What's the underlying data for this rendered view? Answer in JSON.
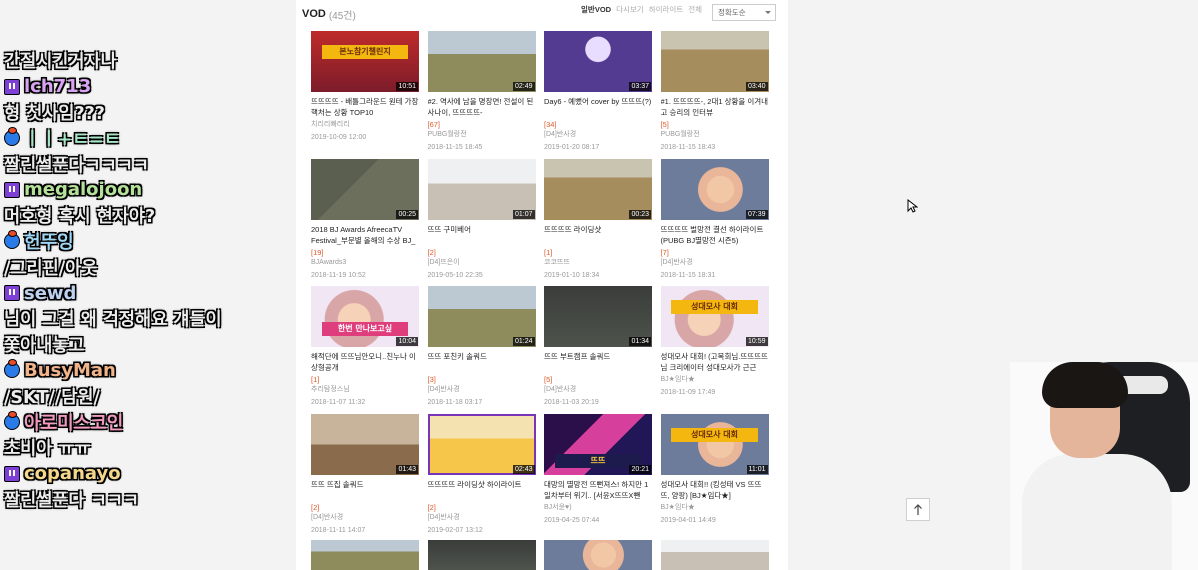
{
  "chat": [
    {
      "kind": "msg",
      "text": "간절시킨거자나"
    },
    {
      "kind": "user",
      "platform": "twitch-icon",
      "name": "lch713",
      "color": "#d9a2f2"
    },
    {
      "kind": "msg",
      "text": "형 첫사임???"
    },
    {
      "kind": "user",
      "platform": "afreeca-icon",
      "name": "ㅣㅣ+ㅌ=ㅌ",
      "color": "#a6e6c6"
    },
    {
      "kind": "msg",
      "text": "짤린썰푼다ㅋㅋㅋㅋ"
    },
    {
      "kind": "user",
      "platform": "twitch-icon",
      "name": "megalojoon",
      "color": "#b5e29b"
    },
    {
      "kind": "msg",
      "text": "머호형 혹시 현자야?"
    },
    {
      "kind": "user",
      "platform": "afreeca-icon",
      "name": "헌뚜잉",
      "color": "#9fd6f4"
    },
    {
      "kind": "msg",
      "text": "/그리핀/아웃"
    },
    {
      "kind": "user",
      "platform": "twitch-icon",
      "name": "sewd",
      "color": "#bcd2ef"
    },
    {
      "kind": "msg",
      "text": "님이 그걸 왜 걱정해요 걔들이"
    },
    {
      "kind": "msg",
      "text": "쫓아내놓고"
    },
    {
      "kind": "user",
      "platform": "afreeca-icon",
      "name": "BusyMan",
      "color": "#f1b38a"
    },
    {
      "kind": "msg",
      "text": "/SKT//담원/"
    },
    {
      "kind": "user",
      "platform": "afreeca-icon",
      "name": "아로미스코인",
      "color": "#f39ac0"
    },
    {
      "kind": "msg",
      "text": "초비아 ㅠㅠ"
    },
    {
      "kind": "user",
      "platform": "twitch-icon",
      "name": "copanayo",
      "color": "#f3d88b"
    },
    {
      "kind": "msg",
      "text": "짤린썰푼다 ㅋㅋㅋ"
    }
  ],
  "vod": {
    "title": "VOD",
    "count": "(45건)",
    "tabs": [
      "일반VOD",
      "다시보기",
      "하이라이트",
      "전체"
    ],
    "sort": "정확도순"
  },
  "cards": [
    {
      "title": "뜨뜨뜨뜨 - 배틀그라운드 원테 가장 핵처는 상황 TOP10",
      "comments": "",
      "author": "치리리빠리리",
      "date": "2019-10-09 12:00",
      "duration": "10:51",
      "art": "t-red",
      "band": "본노참기챌린지",
      "band_style": "yellow"
    },
    {
      "title": "#2. 역사에 남을 명장면! 전설이 된 사나이, 뜨뜨뜨뜨-",
      "comments": "[67]",
      "author": "PUBG월랑전",
      "date": "2018-11-15 18:45",
      "duration": "02:49",
      "art": "t-field",
      "band": "",
      "band_style": ""
    },
    {
      "title": "Day6 - 예뻤어 cover by 뜨뜨뜨(?)",
      "comments": "[34]",
      "author": "[D4]반사경",
      "date": "2019-01-20 08:17",
      "duration": "03:37",
      "art": "t-purple",
      "band": "",
      "band_style": ""
    },
    {
      "title": "#1. 뜨뜨뜨뜨-, 2대1 상황을 이겨내고 승리의 인터뷰",
      "comments": "[5]",
      "author": "PUBG월랑전",
      "date": "2018-11-15 18:43",
      "duration": "03:40",
      "art": "t-field2",
      "band": "",
      "band_style": ""
    },
    {
      "title": "2018 BJ Awards AfreecaTV Festival_부문별 올해의 수상 BJ_뜨",
      "comments": "[19]",
      "author": "BJAwards3",
      "date": "2018-11-19 10:52",
      "duration": "00:25",
      "art": "t-map",
      "band": "",
      "band_style": ""
    },
    {
      "title": "뜨뜨 구미베어",
      "comments": "[2]",
      "author": "[D4]뜨은이",
      "date": "2019-05-10 22:35",
      "duration": "01:07",
      "art": "t-room",
      "band": "",
      "band_style": ""
    },
    {
      "title": "뜨뜨뜨뜨 라이딩샷",
      "comments": "[1]",
      "author": "코코뜨뜨",
      "date": "2019-01-10 18:34",
      "duration": "00:23",
      "art": "t-field2",
      "band": "",
      "band_style": ""
    },
    {
      "title": "뜨뜨뜨뜨 벌망전 결선 하이라이트 (PUBG BJ멸망전 시즌5)",
      "comments": "[7]",
      "author": "[D4]반사경",
      "date": "2018-11-15 18:31",
      "duration": "07:39",
      "art": "t-face",
      "band": "",
      "band_style": ""
    },
    {
      "title": "해적단에 뜨뜨님안오니..친누나 이상형공개",
      "comments": "[1]",
      "author": "추리탐정스님",
      "date": "2018-11-07 11:32",
      "duration": "10:04",
      "art": "t-face2",
      "band": "한번 만나보고싶",
      "band_style": "pink"
    },
    {
      "title": "뜨뜨 포친키 솔쿼드",
      "comments": "[3]",
      "author": "[D4]반사경",
      "date": "2018-11-18 03:17",
      "duration": "01:24",
      "art": "t-field",
      "band": "",
      "band_style": ""
    },
    {
      "title": "뜨뜨 부트캠프 솔쿼드",
      "comments": "[5]",
      "author": "[D4]반사경",
      "date": "2018-11-03 20:19",
      "duration": "01:34",
      "art": "t-dark",
      "band": "",
      "band_style": ""
    },
    {
      "title": "성대모사 대회! (고목회님.뜨뜨뜨뜨님 크리에이터 성대모사가 근근",
      "comments": "",
      "author": "BJ★임다★",
      "date": "2018-11-09 17:49",
      "duration": "10:59",
      "art": "t-face2",
      "band": "성대모사 대회",
      "band_style": "yellow"
    },
    {
      "title": "뜨뜨 뜨집 솔쿼드",
      "comments": "[2]",
      "author": "[D4]반사경",
      "date": "2018-11-11 14:07",
      "duration": "01:43",
      "art": "t-shop",
      "band": "",
      "band_style": ""
    },
    {
      "title": "뜨뜨뜨뜨 라이딩샷 하이라이트",
      "comments": "[2]",
      "author": "[D4]반사경",
      "date": "2019-02-07 13:12",
      "duration": "02:43",
      "art": "t-yellow",
      "band": "",
      "band_style": "",
      "selected": true
    },
    {
      "title": "대망의 멸망전 뜨뻔져스! 하지만 1일차부터 위기.. [서윤X뜨뜨X뺀",
      "comments": "",
      "author": "BJ서윤♥)",
      "date": "2019-04-25 07:44",
      "duration": "20:21",
      "art": "t-neon",
      "band": "뜨뜨",
      "band_style": "gold"
    },
    {
      "title": "성대모사 대회!! (킹성태 VS 뜨뜨뜨, 양팡) [BJ★임다★]",
      "comments": "",
      "author": "BJ★임다★",
      "date": "2019-04-01 14:49",
      "duration": "11:01",
      "art": "t-face",
      "band": "성대모사 대회",
      "band_style": "yellow"
    }
  ],
  "partial_row": [
    "t-field",
    "t-dark",
    "t-face",
    "t-room"
  ]
}
